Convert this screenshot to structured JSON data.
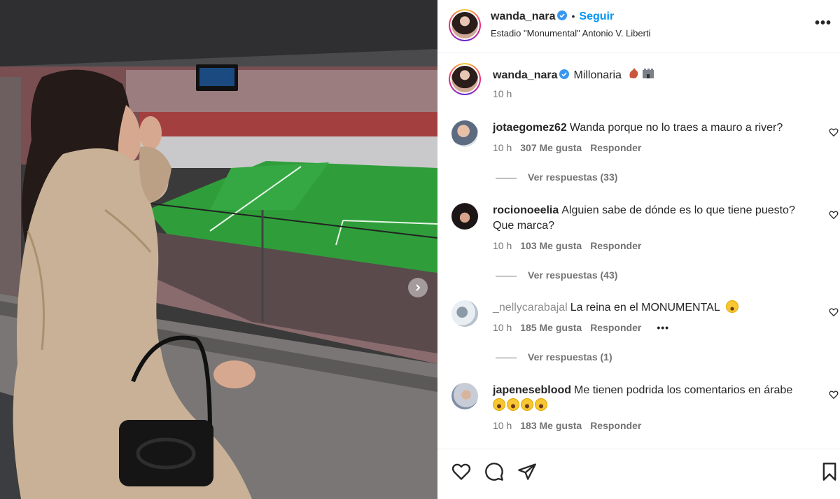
{
  "post": {
    "username": "wanda_nara",
    "follow_label": "Seguir",
    "location": "Estadio \"Monumental\" Antonio V. Liberti",
    "caption_text": "Millonaria",
    "caption_time": "10 h"
  },
  "comments": [
    {
      "username": "jotaegomez62",
      "text": "Wanda porque no lo traes a mauro a river?",
      "time": "10 h",
      "likes": "307 Me gusta",
      "reply": "Responder",
      "view_replies": "Ver respuestas (33)"
    },
    {
      "username": "rocionoeelia",
      "text": "Alguien sabe de dónde es lo que tiene puesto? Que marca?",
      "time": "10 h",
      "likes": "103 Me gusta",
      "reply": "Responder",
      "view_replies": "Ver respuestas (43)"
    },
    {
      "username": "_nellycarabajal",
      "text": "La reina en el MONUMENTAL",
      "time": "10 h",
      "likes": "185 Me gusta",
      "reply": "Responder",
      "more": "•••",
      "view_replies": "Ver respuestas (1)"
    },
    {
      "username": "japeneseblood",
      "text": "Me tienen podrida los comentarios en árabe",
      "time": "10 h",
      "likes": "183 Me gusta",
      "reply": "Responder"
    }
  ],
  "header_more": "•••",
  "icons": {
    "verified": "verified-badge-icon",
    "like": "heart-icon",
    "comment": "comment-icon",
    "share": "share-icon",
    "save": "bookmark-icon",
    "next": "chevron-right-icon"
  },
  "colors": {
    "link": "#0095f6",
    "verified": "#3897f0",
    "text": "#262626",
    "secondary": "#737373",
    "border": "#efefef"
  }
}
